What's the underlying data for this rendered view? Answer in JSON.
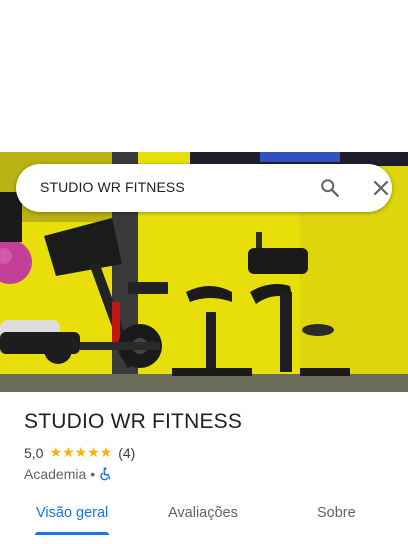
{
  "search": {
    "query": "STUDIO WR FITNESS"
  },
  "place": {
    "name": "STUDIO WR FITNESS",
    "rating": "5,0",
    "stars": "★★★★★",
    "review_count": "(4)",
    "category": "Academia",
    "separator": "•"
  },
  "tabs": [
    {
      "label": "Visão geral",
      "active": true
    },
    {
      "label": "Avaliações",
      "active": false
    },
    {
      "label": "Sobre",
      "active": false
    }
  ],
  "colors": {
    "accent": "#1a73e8",
    "star": "#f5b400",
    "photo_wall": "#e7e00b"
  },
  "icons": [
    "search-icon",
    "close-icon",
    "wheelchair-accessible-icon"
  ]
}
